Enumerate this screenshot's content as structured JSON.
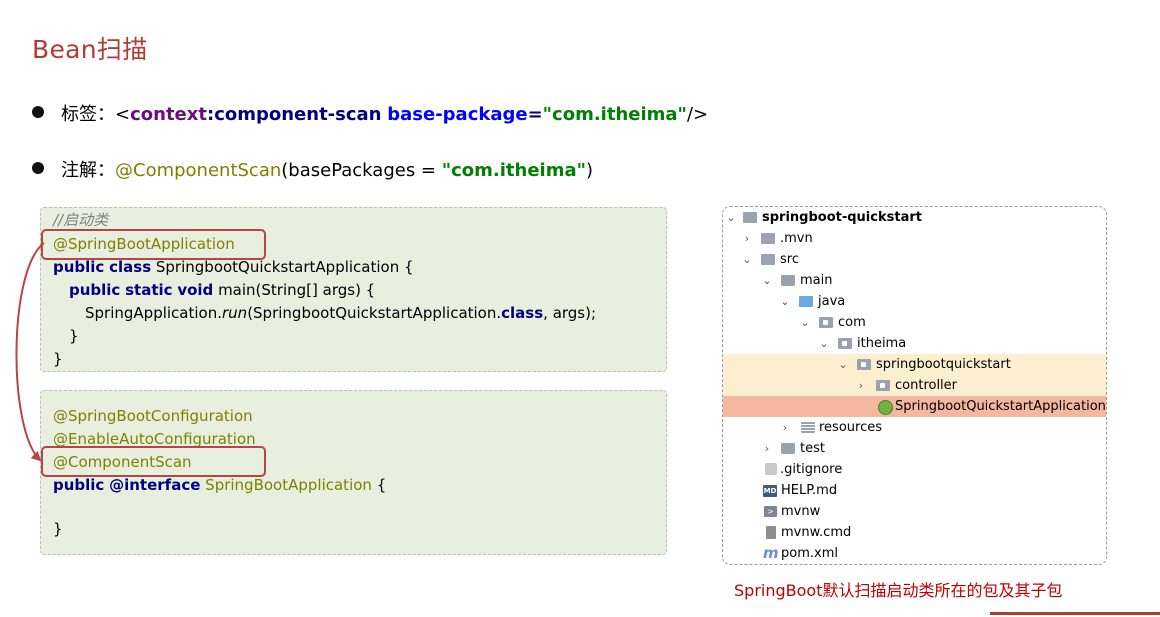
{
  "page": {
    "title": "Bean扫描"
  },
  "bullets": {
    "tag": {
      "label": "标签：",
      "open": "<",
      "ns": "context",
      "colon": ":",
      "element": "component-scan",
      "attr": "base-package",
      "eq": "=",
      "value": "\"com.itheima\"",
      "close": "/>"
    },
    "annotation": {
      "label": "注解：",
      "name": "@ComponentScan",
      "open": "(",
      "param": "basePackages = ",
      "value": "\"com.itheima\"",
      "close": ")"
    }
  },
  "code1": {
    "comment": "//启动类",
    "annotation": "@SpringBootApplication",
    "kw_public": "public",
    "kw_class": "class",
    "class_decl": " SpringbootQuickstartApplication {",
    "kw_static": "static",
    "kw_void": "void",
    "main_sig": " main(String[] args) {",
    "run_prefix": "SpringApplication.",
    "run_method": "run",
    "run_args": "(SpringbootQuickstartApplication.",
    "kw_class2": "class",
    "run_end": ", args);",
    "close_inner": "}",
    "close_outer": "}"
  },
  "code2": {
    "anno1": "@SpringBootConfiguration",
    "anno2": "@EnableAutoConfiguration",
    "anno3": "@ComponentScan",
    "kw_public": "public",
    "kw_interface": "@interface",
    "iface_name": "SpringBootApplication",
    "open_brace": " {",
    "close_brace": "}"
  },
  "tree": {
    "root": "springboot-quickstart",
    "items": [
      {
        "label": ".mvn"
      },
      {
        "label": "src"
      },
      {
        "label": "main"
      },
      {
        "label": "java"
      },
      {
        "label": "com"
      },
      {
        "label": "itheima"
      },
      {
        "label": "springbootquickstart"
      },
      {
        "label": "controller"
      },
      {
        "label": "SpringbootQuickstartApplication"
      },
      {
        "label": "resources"
      },
      {
        "label": "test"
      },
      {
        "label": ".gitignore"
      },
      {
        "label": "HELP.md"
      },
      {
        "label": "mvnw"
      },
      {
        "label": "mvnw.cmd"
      },
      {
        "label": "pom.xml"
      }
    ],
    "md_badge": "MD",
    "maven_glyph": "m"
  },
  "caption": "SpringBoot默认扫描启动类所在的包及其子包",
  "colors": {
    "title": "#b43a36",
    "highlight_border": "#b84545",
    "code_bg": "#e9efdf",
    "caption": "#c00000"
  }
}
